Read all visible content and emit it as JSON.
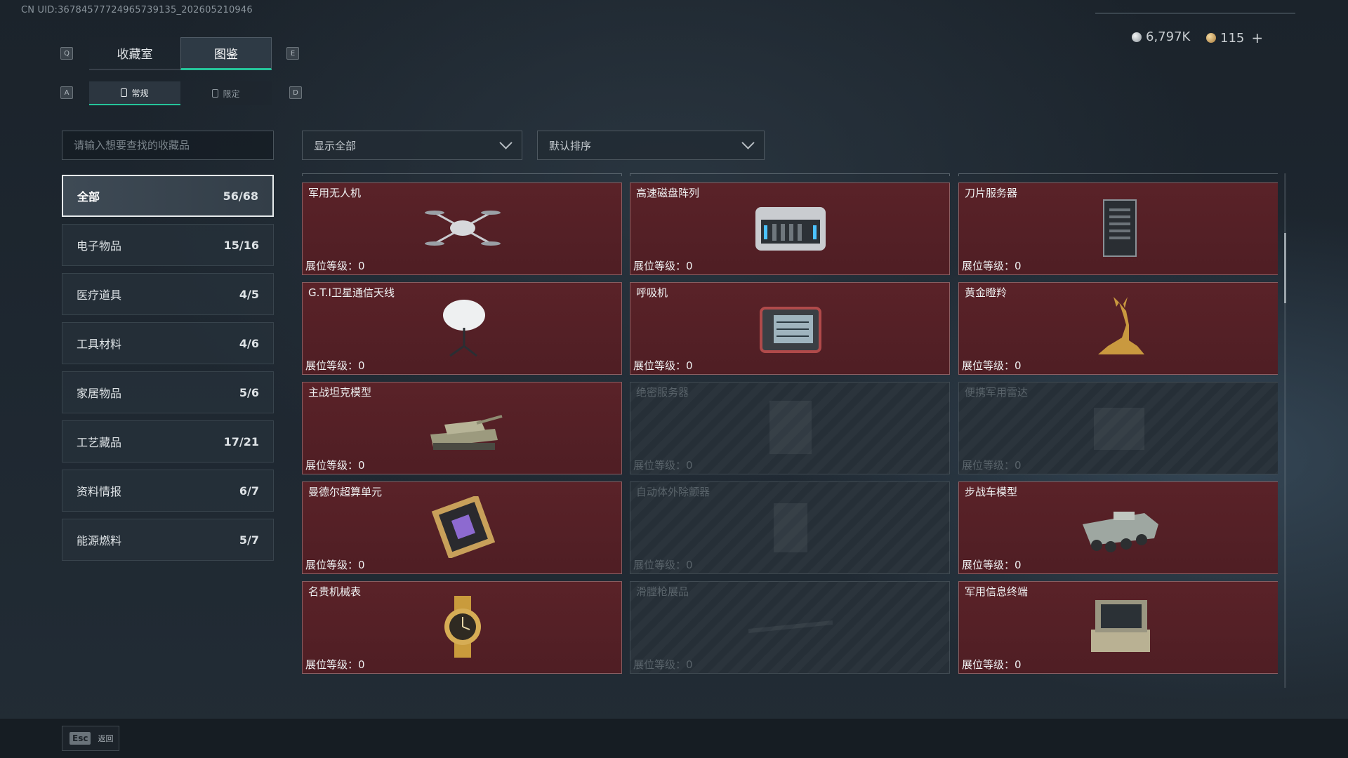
{
  "header": {
    "uid_text": "CN UID:36784577724965739135_202605210946",
    "currency_silver": "6,797K",
    "currency_gold": "115",
    "add_symbol": "+"
  },
  "keys": {
    "prev_tab": "Q",
    "next_tab": "E",
    "prev_sub": "A",
    "next_sub": "D"
  },
  "tabs": [
    {
      "label": "收藏室",
      "active": false
    },
    {
      "label": "图鉴",
      "active": true
    }
  ],
  "sub_tabs": [
    {
      "label": "常规",
      "active": true
    },
    {
      "label": "限定",
      "active": false
    }
  ],
  "search": {
    "placeholder": "请输入想要查找的收藏品"
  },
  "categories": [
    {
      "label": "全部",
      "count": "56/68",
      "active": true
    },
    {
      "label": "电子物品",
      "count": "15/16"
    },
    {
      "label": "医疗道具",
      "count": "4/5"
    },
    {
      "label": "工具材料",
      "count": "4/6"
    },
    {
      "label": "家居物品",
      "count": "5/6"
    },
    {
      "label": "工艺藏品",
      "count": "17/21"
    },
    {
      "label": "资料情报",
      "count": "6/7"
    },
    {
      "label": "能源燃料",
      "count": "5/7"
    }
  ],
  "filters": {
    "show": "显示全部",
    "sort": "默认排序"
  },
  "level_label": "展位等级：",
  "items": [
    {
      "name": "军用无人机",
      "level": "0",
      "owned": true,
      "icon": "drone-icon"
    },
    {
      "name": "高速磁盘阵列",
      "level": "0",
      "owned": true,
      "icon": "disk-array-icon"
    },
    {
      "name": "刀片服务器",
      "level": "0",
      "owned": true,
      "icon": "blade-server-icon"
    },
    {
      "name": "G.T.I卫星通信天线",
      "level": "0",
      "owned": true,
      "icon": "satellite-dish-icon"
    },
    {
      "name": "呼吸机",
      "level": "0",
      "owned": true,
      "icon": "ventilator-icon"
    },
    {
      "name": "黄金瞪羚",
      "level": "0",
      "owned": true,
      "icon": "gold-gazelle-icon"
    },
    {
      "name": "主战坦克模型",
      "level": "0",
      "owned": true,
      "icon": "tank-model-icon"
    },
    {
      "name": "绝密服务器",
      "level": "0",
      "owned": false,
      "icon": "server-icon"
    },
    {
      "name": "便携军用雷达",
      "level": "0",
      "owned": false,
      "icon": "radar-icon"
    },
    {
      "name": "曼德尔超算单元",
      "level": "0",
      "owned": true,
      "icon": "chip-icon"
    },
    {
      "name": "自动体外除颤器",
      "level": "0",
      "owned": false,
      "icon": "defibrillator-icon"
    },
    {
      "name": "步战车模型",
      "level": "0",
      "owned": true,
      "icon": "ifv-model-icon"
    },
    {
      "name": "名贵机械表",
      "level": "0",
      "owned": true,
      "icon": "watch-icon"
    },
    {
      "name": "滑膛枪展品",
      "level": "0",
      "owned": false,
      "icon": "musket-icon"
    },
    {
      "name": "军用信息终端",
      "level": "0",
      "owned": true,
      "icon": "terminal-icon"
    }
  ],
  "bottom": {
    "esc_key": "Esc",
    "back_label": "返回"
  },
  "colors": {
    "accent": "#25c49a",
    "owned_card": "#5a2228"
  }
}
